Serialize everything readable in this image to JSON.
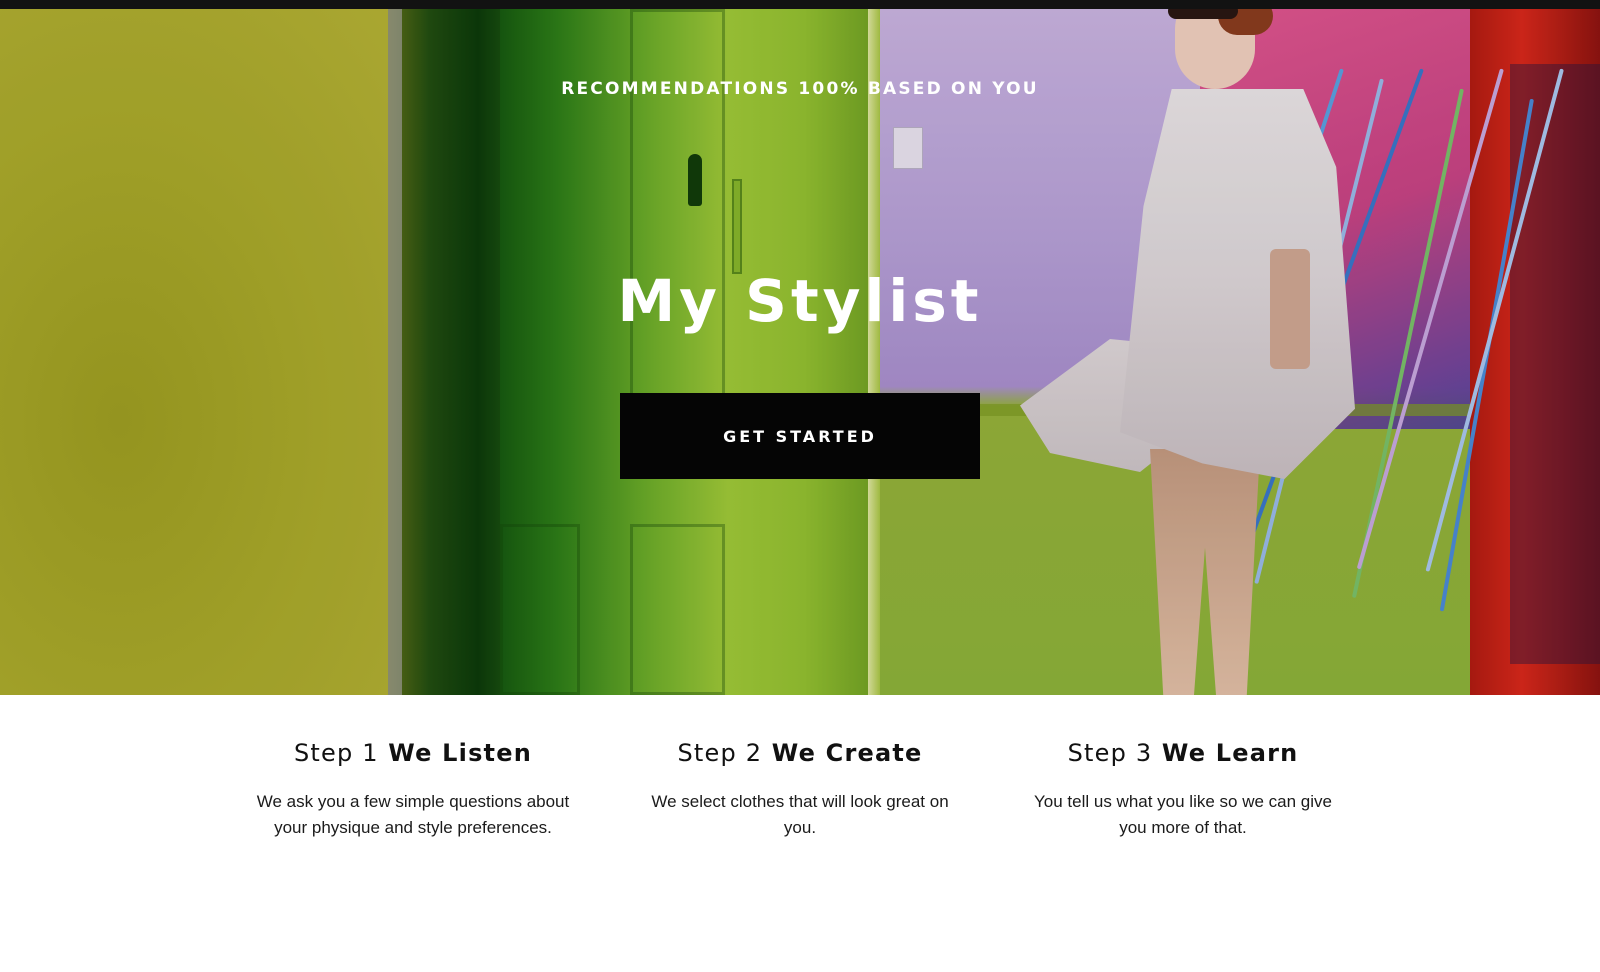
{
  "hero": {
    "tagline": "RECOMMENDATIONS 100% BASED ON YOU",
    "title": "My Stylist",
    "cta_label": "GET STARTED"
  },
  "steps": [
    {
      "number": "Step 1",
      "name": "We Listen",
      "description": "We ask you a few simple questions about your physique and style preferences."
    },
    {
      "number": "Step 2",
      "name": "We Create",
      "description": "We select clothes that will look great on you."
    },
    {
      "number": "Step 3",
      "name": "We Learn",
      "description": "You tell us what you like so we can give you more of that."
    }
  ],
  "colors": {
    "cta_background": "#050505",
    "text_dark": "#111111",
    "hero_text": "#ffffff"
  }
}
